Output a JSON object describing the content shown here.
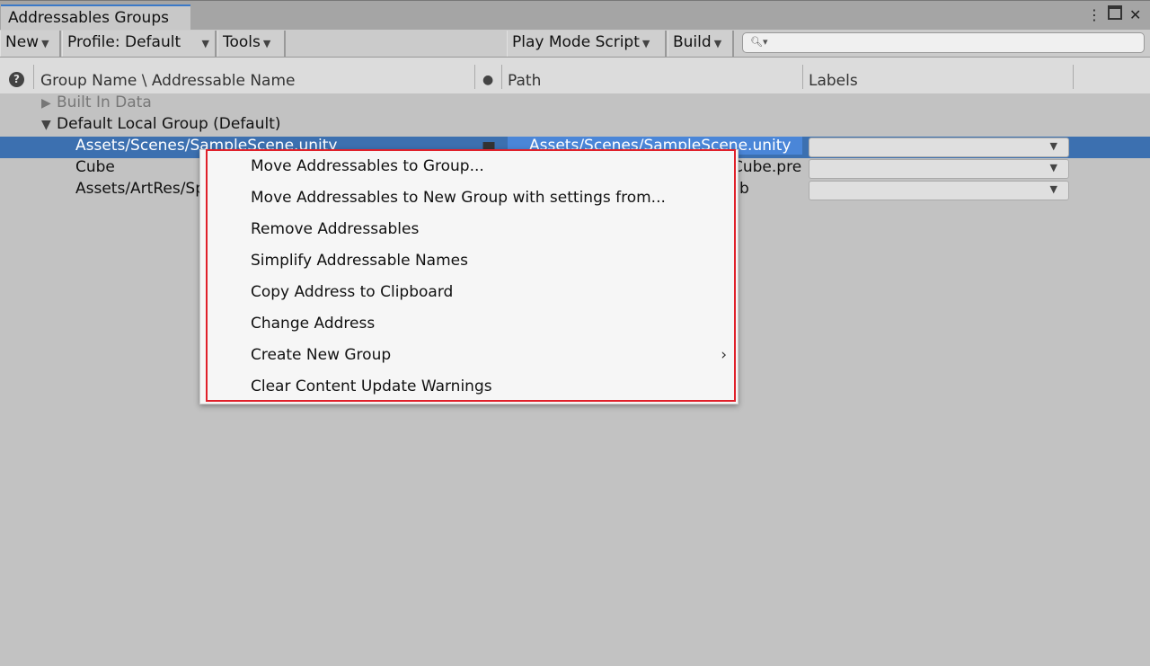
{
  "window": {
    "tab_title": "Addressables Groups",
    "more_icon": "kebab-icon",
    "maximize_icon": "maximize-icon",
    "close_icon": "close-icon"
  },
  "toolbar": {
    "new": "New",
    "profile": "Profile: Default",
    "tools": "Tools",
    "play_mode": "Play Mode Script",
    "build": "Build",
    "search_placeholder": "",
    "search_icon": "search-icon"
  },
  "columns": {
    "help_icon": "help-icon",
    "group_name": "Group Name \\ Addressable Name",
    "type_icon": "asset-type-icon",
    "path": "Path",
    "labels": "Labels"
  },
  "tree": {
    "groups": [
      {
        "name": "Built In Data",
        "expanded": false
      },
      {
        "name": "Default Local Group (Default)",
        "expanded": true
      }
    ],
    "entries": [
      {
        "name": "Assets/Scenes/SampleScene.unity",
        "path": "Assets/Scenes/SampleScene.unity",
        "selected": true
      },
      {
        "name": "Cube",
        "path": "Cube.pre",
        "selected": false
      },
      {
        "name": "Assets/ArtRes/Sp",
        "path": "b",
        "selected": false
      }
    ]
  },
  "context_menu": {
    "items": [
      {
        "label": "Move Addressables to Group..."
      },
      {
        "label": "Move Addressables to New Group with settings from..."
      },
      {
        "label": "Remove Addressables"
      },
      {
        "label": "Simplify Addressable Names"
      },
      {
        "label": "Copy Address to Clipboard"
      },
      {
        "label": "Change Address"
      },
      {
        "label": "Create New Group",
        "submenu": true
      },
      {
        "label": "Clear Content Update Warnings"
      }
    ],
    "highlight_color": "#e0202a"
  },
  "colors": {
    "selection": "#3c70b0",
    "tab_accent": "#3a79c8"
  }
}
